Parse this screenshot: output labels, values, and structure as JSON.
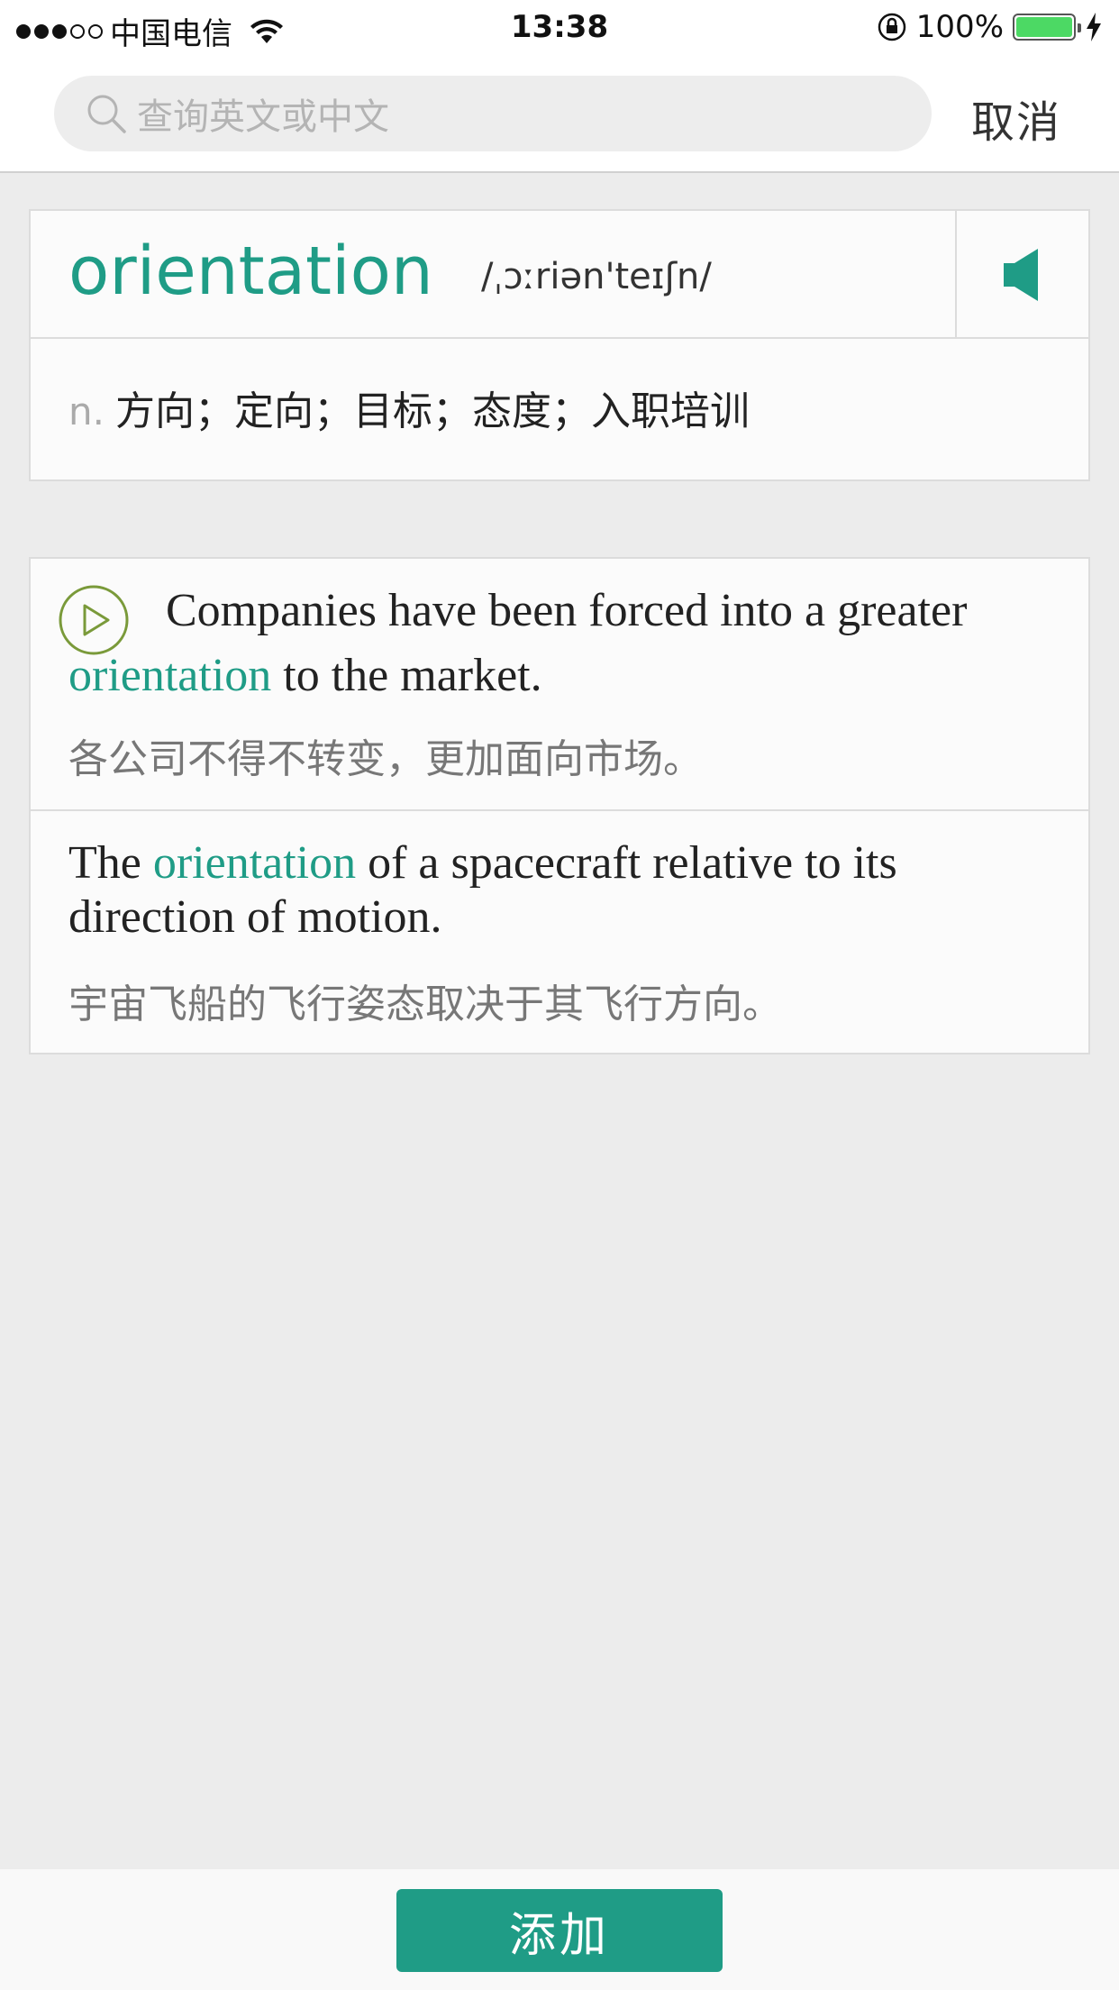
{
  "status_bar": {
    "carrier": "中国电信",
    "time": "13:38",
    "battery": "100%",
    "signal_bars_filled": 3,
    "signal_bars_total": 5,
    "battery_level": 1.0
  },
  "search": {
    "placeholder": "查询英文或中文",
    "cancel_label": "取消"
  },
  "word": {
    "headword": "orientation",
    "phonetic": "/ˌɔːriən'teɪʃn/",
    "part_of_speech": "n.",
    "definition": "方向；定向；目标；态度；入职培训"
  },
  "examples": [
    {
      "en_before": "Companies have been forced into a greater",
      "en_highlight": "orientation",
      "en_after": "to the market.",
      "cn": "各公司不得不转变，更加面向市场。"
    },
    {
      "en_before": "The",
      "en_highlight": "orientation",
      "en_after": "of a spacecraft relative to its direction of motion.",
      "cn": "宇宙飞船的飞行姿态取决于其飞行方向。"
    }
  ],
  "actions": {
    "add_label": "添加"
  },
  "colors": {
    "accent": "#1f9c86",
    "battery": "#4cd964",
    "background": "#ececec"
  }
}
